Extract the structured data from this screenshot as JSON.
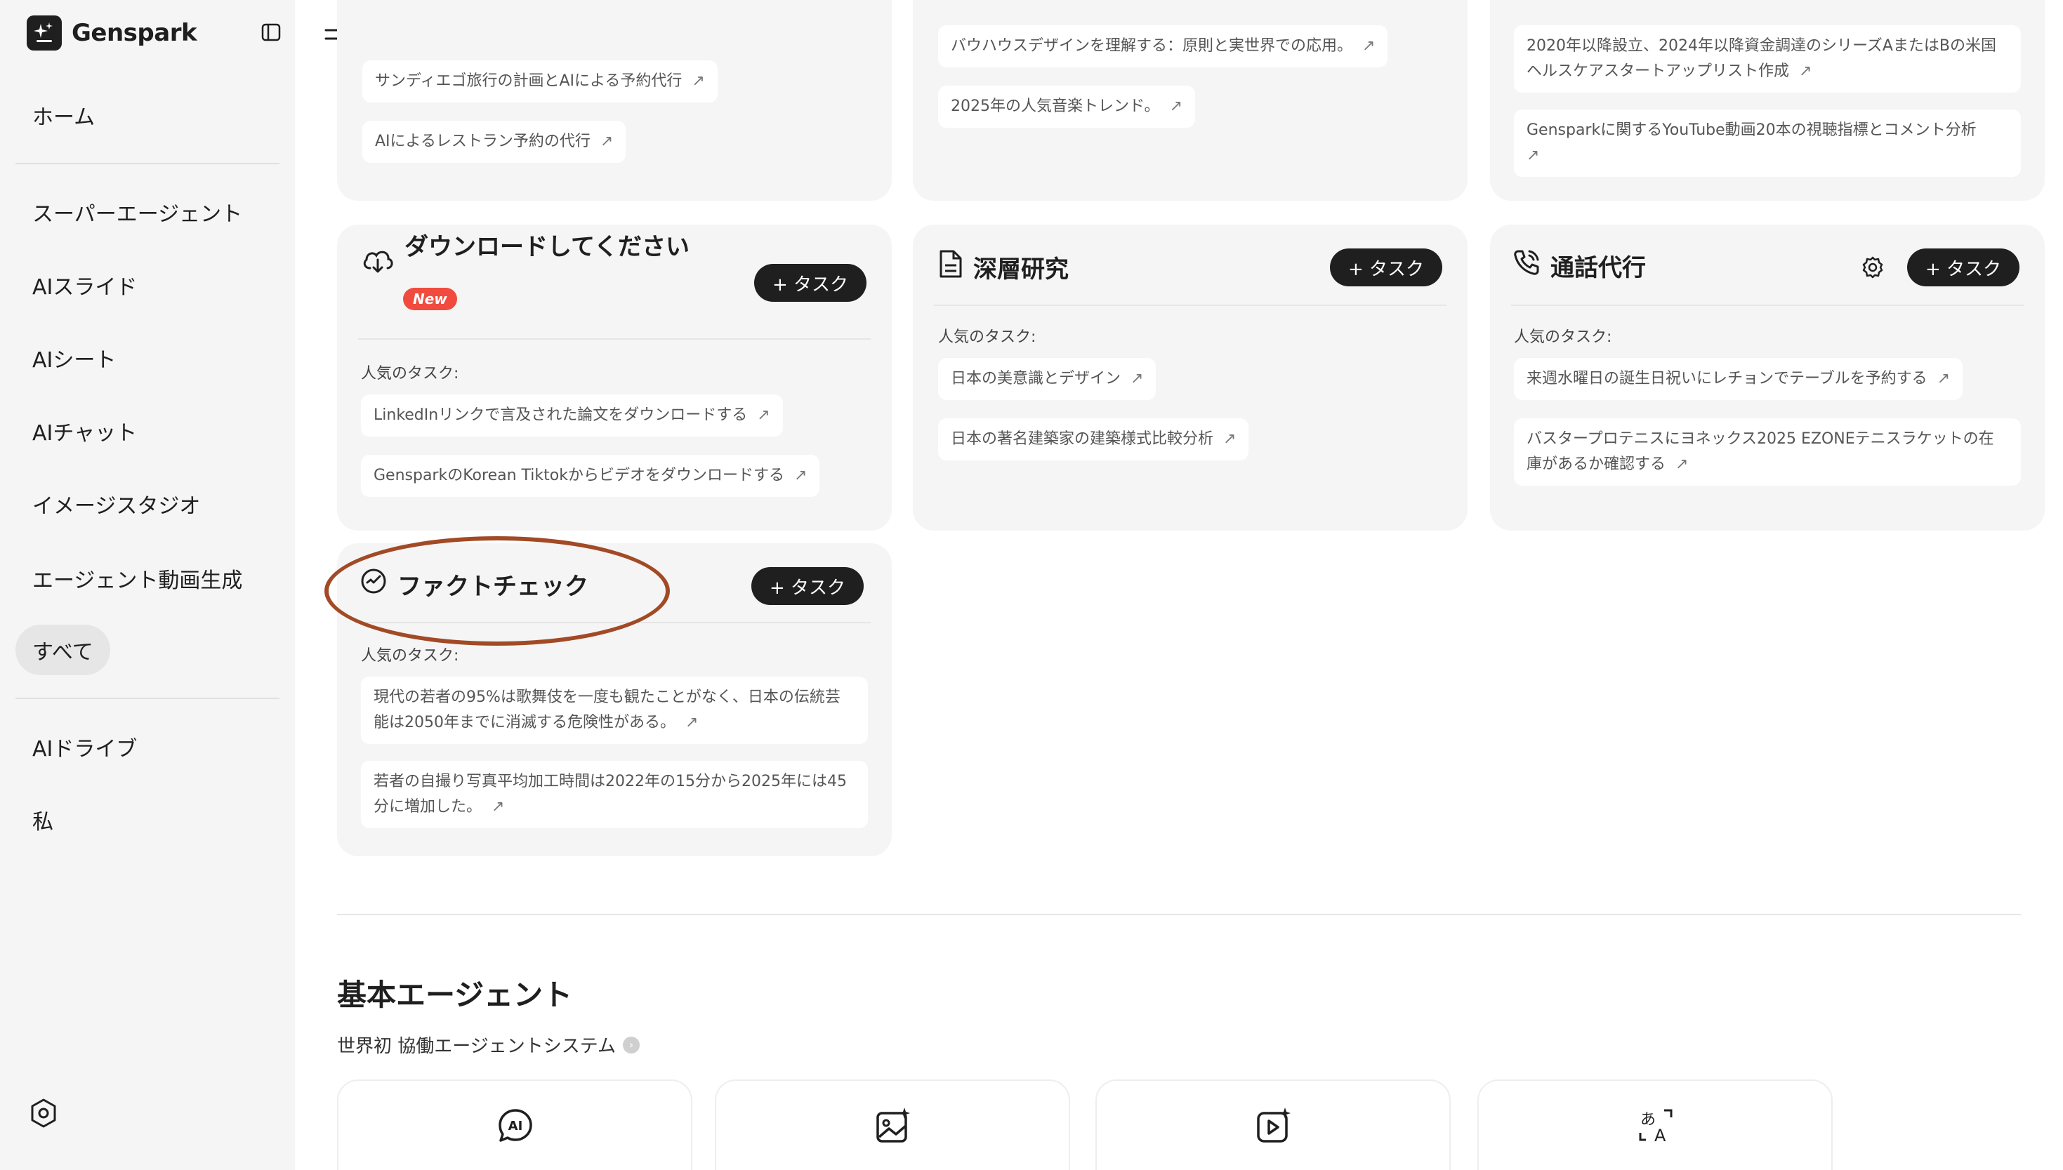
{
  "app": {
    "name": "Genspark"
  },
  "sidebar": {
    "items": [
      {
        "label": "ホーム"
      },
      {
        "label": "スーパーエージェント"
      },
      {
        "label": "AIスライド"
      },
      {
        "label": "AIシート"
      },
      {
        "label": "AIチャット"
      },
      {
        "label": "イメージスタジオ"
      },
      {
        "label": "エージェント動画生成"
      },
      {
        "label": "すべて",
        "active": true
      },
      {
        "label": "AIドライブ"
      },
      {
        "label": "私"
      }
    ]
  },
  "top_cards": {
    "left": {
      "chips": [
        "サンディエゴ旅行の計画とAIによる予約代行",
        "AIによるレストラン予約の代行"
      ]
    },
    "middle": {
      "chips": [
        "バウハウスデザインを理解する：原則と実世界での応用。",
        "2025年の人気音楽トレンド。"
      ]
    },
    "right": {
      "chips": [
        "2020年以降設立、2024年以降資金調達のシリーズAまたはBの米国ヘルスケアスタートアップリスト作成",
        "Gensparkに関するYouTube動画20本の視聴指標とコメント分析"
      ]
    }
  },
  "cards": {
    "download": {
      "title": "ダウンロードしてください",
      "badge": "New",
      "task_button": "+ タスク",
      "popular_label": "人気のタスク:",
      "chips": [
        "LinkedInリンクで言及された論文をダウンロードする",
        "GensparkのKorean Tiktokからビデオをダウンロードする"
      ]
    },
    "deep_research": {
      "title": "深層研究",
      "task_button": "+ タスク",
      "popular_label": "人気のタスク:",
      "chips": [
        "日本の美意識とデザイン",
        "日本の著名建築家の建築様式比較分析"
      ]
    },
    "call": {
      "title": "通話代行",
      "task_button": "+ タスク",
      "popular_label": "人気のタスク:",
      "chips": [
        "来週水曜日の誕生日祝いにレチョンでテーブルを予約する",
        "バスタープロテニスにヨネックス2025 EZONEテニスラケットの在庫があるか確認する"
      ]
    },
    "fact_check": {
      "title": "ファクトチェック",
      "task_button": "+ タスク",
      "popular_label": "人気のタスク:",
      "chips": [
        "現代の若者の95%は歌舞伎を一度も観たことがなく、日本の伝統芸能は2050年までに消滅する危険性がある。",
        "若者の自撮り写真平均加工時間は2022年の15分から2025年には45分に増加した。"
      ]
    }
  },
  "arrow_glyph": "↗",
  "basic_agents": {
    "title": "基本エージェント",
    "subtitle": "世界初 協働エージェントシステム",
    "agents": [
      {
        "icon": "ai-chat-icon",
        "label": "AIチャット"
      },
      {
        "icon": "image-studio-icon",
        "label": "イメージスタジオ"
      },
      {
        "icon": "video-generation-icon",
        "label": "ビデオ生成"
      },
      {
        "icon": "translate-icon",
        "label": "翻訳"
      }
    ]
  },
  "colors": {
    "accent_dark": "#1f1f1f",
    "new_badge": "#f04b3e",
    "highlight_oval": "#a24a25",
    "sidebar_bg": "#f5f5f5",
    "card_bg": "#f5f5f5"
  }
}
